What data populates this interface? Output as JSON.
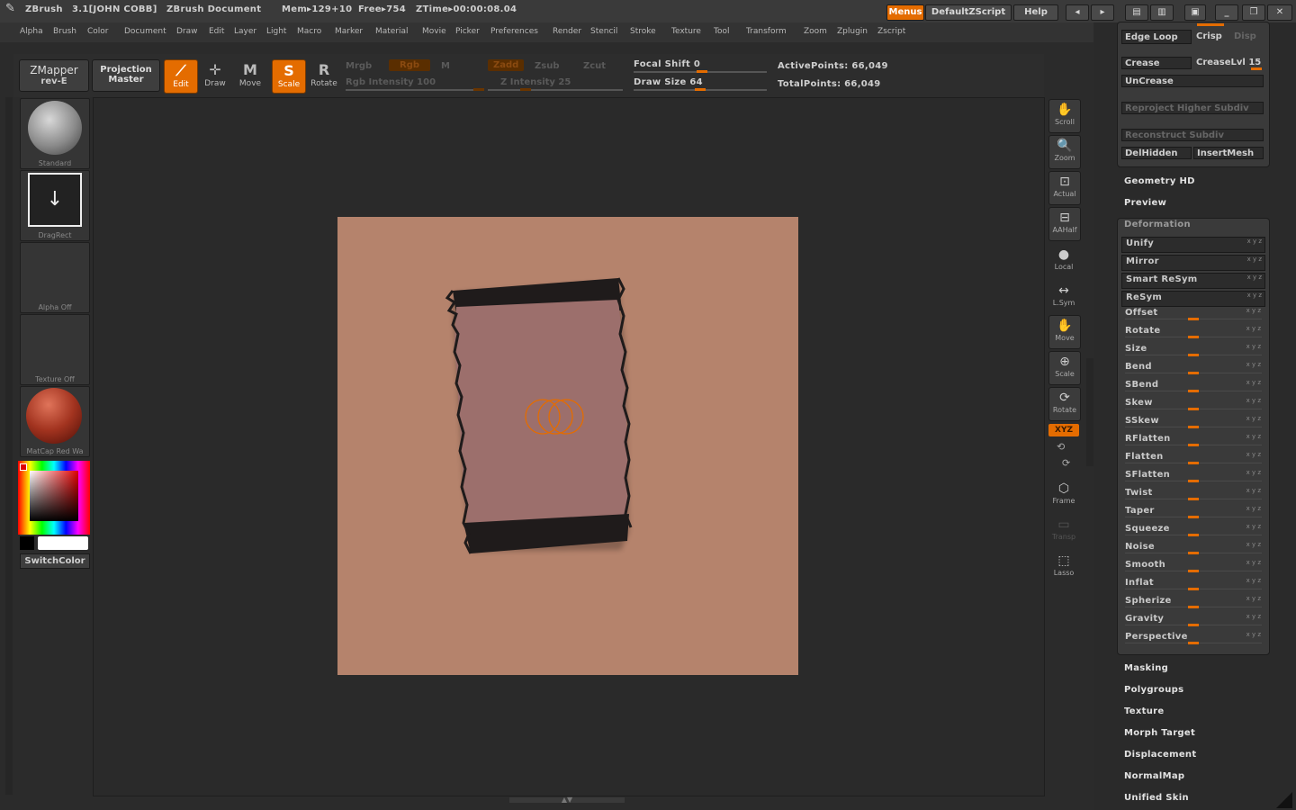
{
  "titlebar": {
    "app": "ZBrush",
    "version": "3.1[JOHN COBB]",
    "document": "ZBrush Document",
    "mem": "Mem▸129+10",
    "free": "Free▸754",
    "ztime": "ZTime▸00:00:08.04",
    "menus": "Menus",
    "zscript": "DefaultZScript",
    "help": "Help"
  },
  "menubar": {
    "items": [
      "Alpha",
      "Brush",
      "Color",
      "Document",
      "Draw",
      "Edit",
      "Layer",
      "Light",
      "Macro",
      "Marker",
      "Material",
      "Movie",
      "Picker",
      "Preferences",
      "Render",
      "Stencil",
      "Stroke",
      "Texture",
      "Tool",
      "Transform",
      "Zoom",
      "Zplugin",
      "Zscript"
    ]
  },
  "shelf": {
    "zmapper": "ZMapper",
    "zmapper_sub": "rev-E",
    "projection": "Projection",
    "projection_sub": "Master",
    "edit": "Edit",
    "draw": "Draw",
    "move": "Move",
    "scale": "Scale",
    "rotate": "Rotate",
    "mrgb": "Mrgb",
    "rgb": "Rgb",
    "m": "M",
    "rgb_intensity": "Rgb Intensity 100",
    "zadd": "Zadd",
    "zsub": "Zsub",
    "zcut": "Zcut",
    "z_intensity": "Z Intensity 25",
    "focal_shift": "Focal Shift 0",
    "draw_size": "Draw Size 64",
    "active_points": "ActivePoints: 66,049",
    "total_points": "TotalPoints: 66,049"
  },
  "left_tray": {
    "standard": "Standard",
    "dragrect": "DragRect",
    "alpha": "Alpha Off",
    "texture": "Texture Off",
    "material": "MatCap Red Wa",
    "switchcolor": "SwitchColor"
  },
  "right_shelf": {
    "scroll": "Scroll",
    "zoom": "Zoom",
    "actual": "Actual",
    "aahalf": "AAHalf",
    "local": "Local",
    "lsym": "L.Sym",
    "move": "Move",
    "scale": "Scale",
    "rotate": "Rotate",
    "xyz": "XYZ",
    "frame": "Frame",
    "transp": "Transp",
    "lasso": "Lasso"
  },
  "geometry": {
    "edge_loop": "Edge Loop",
    "crisp": "Crisp",
    "disp": "Disp",
    "crease": "Crease",
    "creaselvl": "CreaseLvl 15",
    "uncrease": "UnCrease",
    "reproject": "Reproject Higher Subdiv",
    "reconstruct": "Reconstruct Subdiv",
    "delhidden": "DelHidden",
    "insertmesh": "InsertMesh"
  },
  "sections": {
    "geometry_hd": "Geometry HD",
    "preview": "Preview",
    "deformation": "Deformation",
    "masking": "Masking",
    "polygroups": "Polygroups",
    "texture": "Texture",
    "morph_target": "Morph Target",
    "displacement": "Displacement",
    "normalmap": "NormalMap",
    "unified_skin": "Unified Skin"
  },
  "deformation": [
    {
      "label": "Unify",
      "boxed": true
    },
    {
      "label": "Mirror",
      "boxed": true
    },
    {
      "label": "Smart ReSym",
      "boxed": true
    },
    {
      "label": "ReSym",
      "boxed": true
    },
    {
      "label": "Offset",
      "boxed": false
    },
    {
      "label": "Rotate",
      "boxed": false
    },
    {
      "label": "Size",
      "boxed": false
    },
    {
      "label": "Bend",
      "boxed": false
    },
    {
      "label": "SBend",
      "boxed": false
    },
    {
      "label": "Skew",
      "boxed": false
    },
    {
      "label": "SSkew",
      "boxed": false
    },
    {
      "label": "RFlatten",
      "boxed": false
    },
    {
      "label": "Flatten",
      "boxed": false
    },
    {
      "label": "SFlatten",
      "boxed": false
    },
    {
      "label": "Twist",
      "boxed": false
    },
    {
      "label": "Taper",
      "boxed": false
    },
    {
      "label": "Squeeze",
      "boxed": false
    },
    {
      "label": "Noise",
      "boxed": false
    },
    {
      "label": "Smooth",
      "boxed": false
    },
    {
      "label": "Inflat",
      "boxed": false
    },
    {
      "label": "Spherize",
      "boxed": false
    },
    {
      "label": "Gravity",
      "boxed": false
    },
    {
      "label": "Perspective",
      "boxed": false
    }
  ],
  "colors": {
    "accent": "#e46c00",
    "document_bg": "#b5836c",
    "mesh": "#9c6f6c"
  }
}
